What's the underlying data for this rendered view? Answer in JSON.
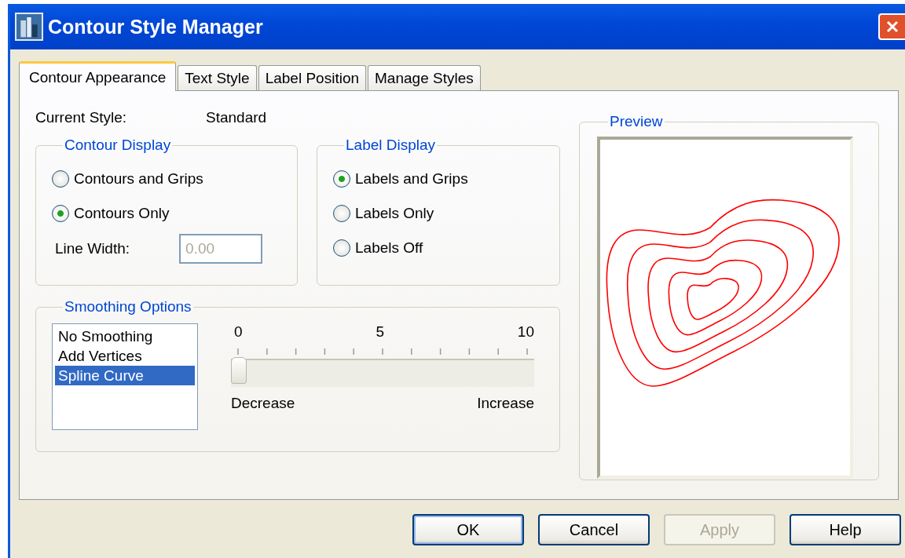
{
  "window": {
    "title": "Contour Style Manager"
  },
  "tabs": [
    {
      "label": "Contour Appearance",
      "selected": true
    },
    {
      "label": "Text Style",
      "selected": false
    },
    {
      "label": "Label Position",
      "selected": false
    },
    {
      "label": "Manage Styles",
      "selected": false
    }
  ],
  "current_style": {
    "label": "Current Style:",
    "value": "Standard"
  },
  "contour_display": {
    "title": "Contour Display",
    "options": [
      {
        "label": "Contours and Grips",
        "selected": false
      },
      {
        "label": "Contours Only",
        "selected": true
      }
    ],
    "line_width": {
      "label": "Line Width:",
      "value": "0.00",
      "disabled": true
    }
  },
  "label_display": {
    "title": "Label Display",
    "options": [
      {
        "label": "Labels and Grips",
        "selected": true
      },
      {
        "label": "Labels Only",
        "selected": false
      },
      {
        "label": "Labels Off",
        "selected": false
      }
    ]
  },
  "smoothing": {
    "title": "Smoothing Options",
    "methods": [
      {
        "label": "No Smoothing",
        "selected": false
      },
      {
        "label": "Add Vertices",
        "selected": false
      },
      {
        "label": "Spline Curve",
        "selected": true
      }
    ],
    "scale": {
      "ticks": [
        "0",
        "5",
        "10"
      ],
      "level": 0,
      "min_label": "Decrease",
      "max_label": "Increase"
    }
  },
  "preview": {
    "title": "Preview"
  },
  "buttons": [
    {
      "label": "OK",
      "default": true,
      "disabled": false
    },
    {
      "label": "Cancel",
      "default": false,
      "disabled": false
    },
    {
      "label": "Apply",
      "default": false,
      "disabled": true
    },
    {
      "label": "Help",
      "default": false,
      "disabled": false
    }
  ]
}
